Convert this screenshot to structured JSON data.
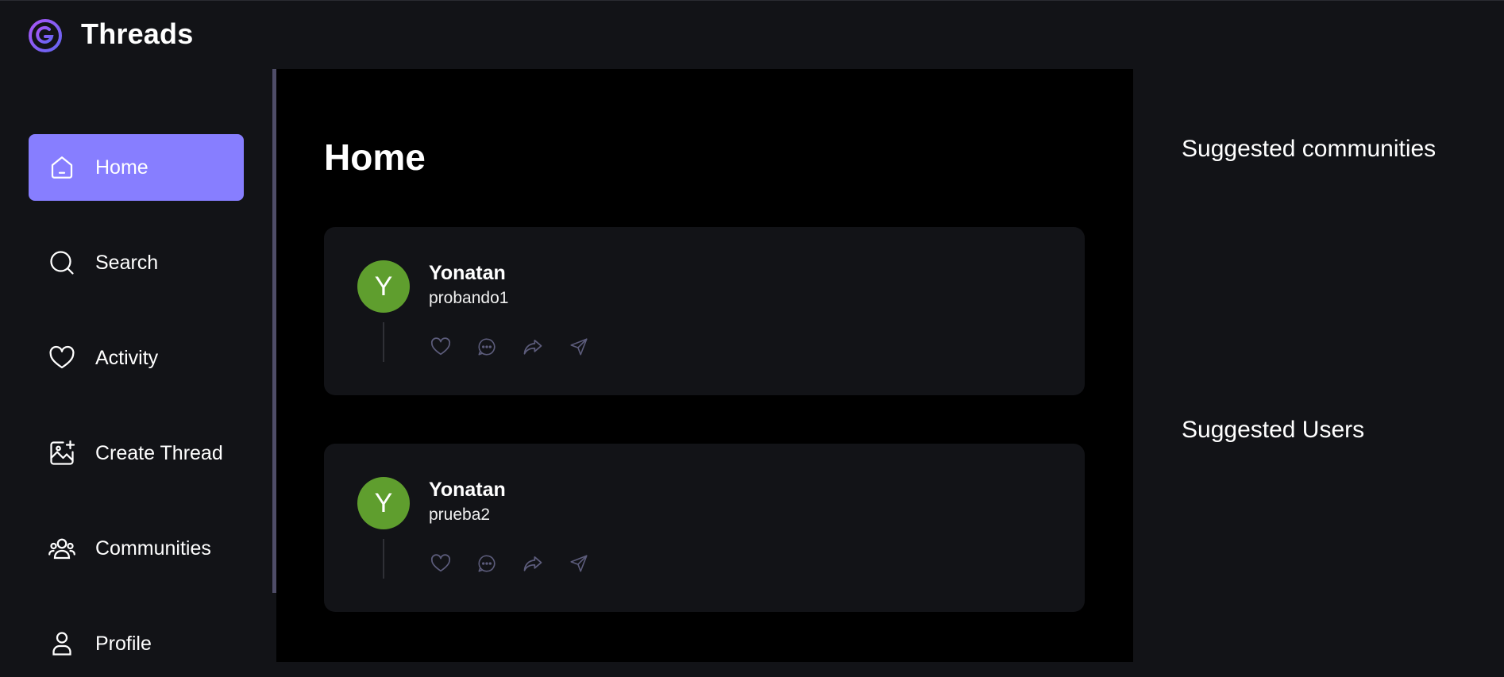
{
  "app": {
    "title": "Threads"
  },
  "sidebar": {
    "items": [
      {
        "label": "Home",
        "icon": "home-icon",
        "active": true
      },
      {
        "label": "Search",
        "icon": "search-icon",
        "active": false
      },
      {
        "label": "Activity",
        "icon": "heart-icon",
        "active": false
      },
      {
        "label": "Create Thread",
        "icon": "image-plus-icon",
        "active": false
      },
      {
        "label": "Communities",
        "icon": "users-icon",
        "active": false
      },
      {
        "label": "Profile",
        "icon": "user-icon",
        "active": false
      }
    ]
  },
  "main": {
    "title": "Home",
    "threads": [
      {
        "author": "Yonatan",
        "avatar_initial": "Y",
        "content": "probando1"
      },
      {
        "author": "Yonatan",
        "avatar_initial": "Y",
        "content": "prueba2"
      }
    ]
  },
  "rightbar": {
    "communities_heading": "Suggested communities",
    "users_heading": "Suggested Users"
  },
  "colors": {
    "background": "#121317",
    "main_background": "#000000",
    "accent": "#877eff",
    "avatar": "#5f9e2e",
    "icon_muted": "#5c5c7b"
  }
}
